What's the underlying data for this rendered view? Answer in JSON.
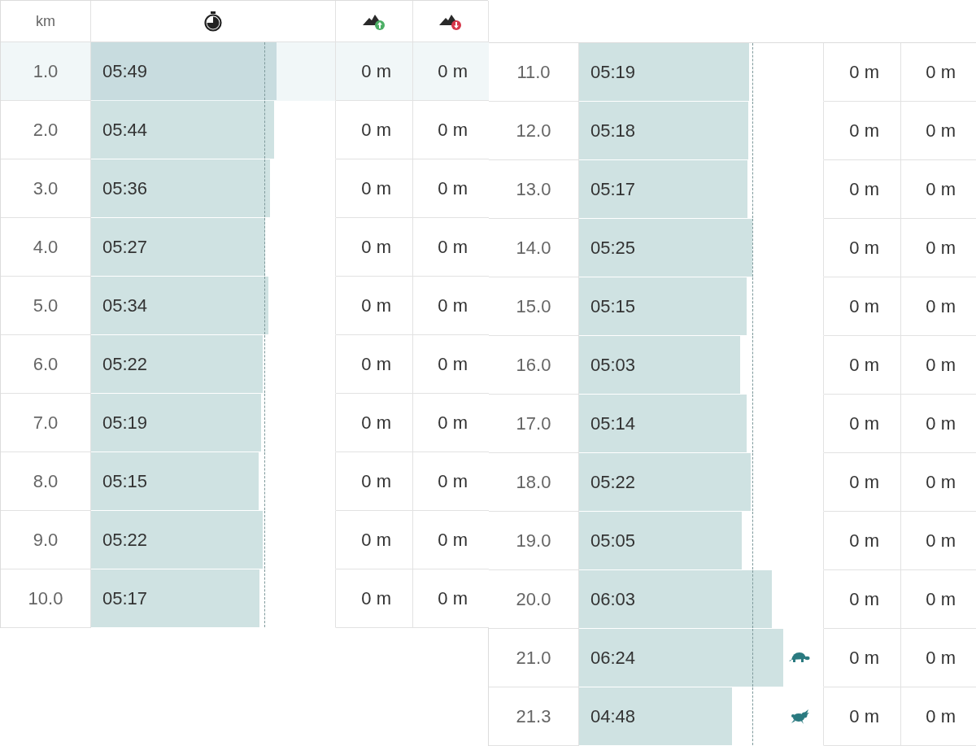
{
  "average": {
    "level": 0.711
  },
  "tables": [
    {
      "columns": [
        {
          "kind": "label",
          "label": "km"
        },
        {
          "kind": "time"
        },
        {
          "kind": "ascent"
        },
        {
          "kind": "descent"
        }
      ],
      "rows": [
        {
          "km": "1.0",
          "pace": "05:49",
          "level": 0.761,
          "ascent": "0 m",
          "descent": "0 m",
          "selected": true
        },
        {
          "km": "2.0",
          "pace": "05:44",
          "level": 0.75,
          "ascent": "0 m",
          "descent": "0 m",
          "selected": false
        },
        {
          "km": "3.0",
          "pace": "05:36",
          "level": 0.733,
          "ascent": "0 m",
          "descent": "0 m",
          "selected": false
        },
        {
          "km": "4.0",
          "pace": "05:27",
          "level": 0.713,
          "ascent": "0 m",
          "descent": "0 m",
          "selected": false
        },
        {
          "km": "5.0",
          "pace": "05:34",
          "level": 0.728,
          "ascent": "0 m",
          "descent": "0 m",
          "selected": false
        },
        {
          "km": "6.0",
          "pace": "05:22",
          "level": 0.702,
          "ascent": "0 m",
          "descent": "0 m",
          "selected": false
        },
        {
          "km": "7.0",
          "pace": "05:19",
          "level": 0.696,
          "ascent": "0 m",
          "descent": "0 m",
          "selected": false
        },
        {
          "km": "8.0",
          "pace": "05:15",
          "level": 0.687,
          "ascent": "0 m",
          "descent": "0 m",
          "selected": false
        },
        {
          "km": "9.0",
          "pace": "05:22",
          "level": 0.702,
          "ascent": "0 m",
          "descent": "0 m",
          "selected": false
        },
        {
          "km": "10.0",
          "pace": "05:17",
          "level": 0.691,
          "ascent": "0 m",
          "descent": "0 m",
          "selected": false
        }
      ]
    },
    {
      "rows": [
        {
          "km": "11.0",
          "pace": "05:19",
          "level": 0.696,
          "ascent": "0 m",
          "descent": "0 m",
          "selected": false
        },
        {
          "km": "12.0",
          "pace": "05:18",
          "level": 0.693,
          "ascent": "0 m",
          "descent": "0 m",
          "selected": false
        },
        {
          "km": "13.0",
          "pace": "05:17",
          "level": 0.691,
          "ascent": "0 m",
          "descent": "0 m",
          "selected": false
        },
        {
          "km": "14.0",
          "pace": "05:25",
          "level": 0.709,
          "ascent": "0 m",
          "descent": "0 m",
          "selected": false
        },
        {
          "km": "15.0",
          "pace": "05:15",
          "level": 0.687,
          "ascent": "0 m",
          "descent": "0 m",
          "selected": false
        },
        {
          "km": "16.0",
          "pace": "05:03",
          "level": 0.661,
          "ascent": "0 m",
          "descent": "0 m",
          "selected": false
        },
        {
          "km": "17.0",
          "pace": "05:14",
          "level": 0.685,
          "ascent": "0 m",
          "descent": "0 m",
          "selected": false
        },
        {
          "km": "18.0",
          "pace": "05:22",
          "level": 0.702,
          "ascent": "0 m",
          "descent": "0 m",
          "selected": false
        },
        {
          "km": "19.0",
          "pace": "05:05",
          "level": 0.665,
          "ascent": "0 m",
          "descent": "0 m",
          "selected": false
        },
        {
          "km": "20.0",
          "pace": "06:03",
          "level": 0.79,
          "ascent": "0 m",
          "descent": "0 m",
          "selected": false
        },
        {
          "km": "21.0",
          "pace": "06:24",
          "level": 0.837,
          "ascent": "0 m",
          "descent": "0 m",
          "selected": false,
          "kind": "slowest"
        },
        {
          "km": "21.3",
          "pace": "04:48",
          "level": 0.628,
          "ascent": "0 m",
          "descent": "0 m",
          "selected": false,
          "kind": "fastest"
        }
      ]
    }
  ]
}
